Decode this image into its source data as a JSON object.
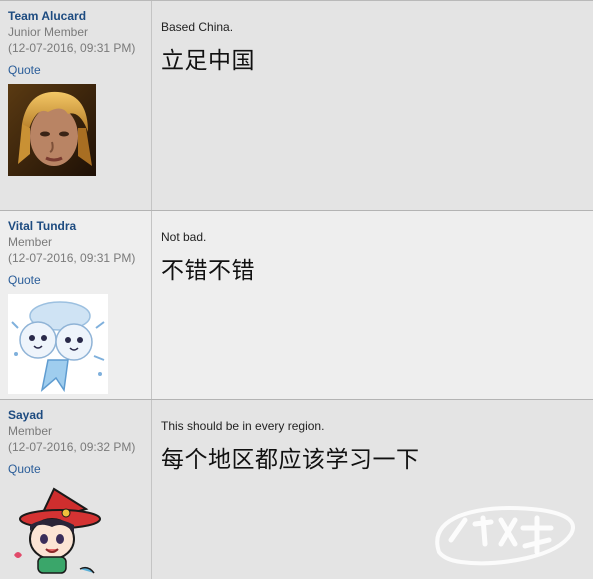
{
  "posts": [
    {
      "username": "Team Alucard",
      "rank": "Junior Member",
      "date": "(12-07-2016, 09:31 PM)",
      "quote_label": "Quote",
      "message_en": "Based China.",
      "message_zh": "立足中国"
    },
    {
      "username": "Vital Tundra",
      "rank": "Member",
      "date": "(12-07-2016, 09:31 PM)",
      "quote_label": "Quote",
      "message_en": "Not bad.",
      "message_zh": "不错不错"
    },
    {
      "username": "Sayad",
      "rank": "Member",
      "date": "(12-07-2016, 09:32 PM)",
      "quote_label": "Quote",
      "message_en": "This should be in every region.",
      "message_zh": "每个地区都应该学习一下"
    }
  ],
  "watermark": {
    "text": "游戏 蜂窝"
  },
  "colors": {
    "username": "#1d4b80",
    "quote_link": "#2a5d99",
    "meta_text": "#7a7a7a"
  }
}
